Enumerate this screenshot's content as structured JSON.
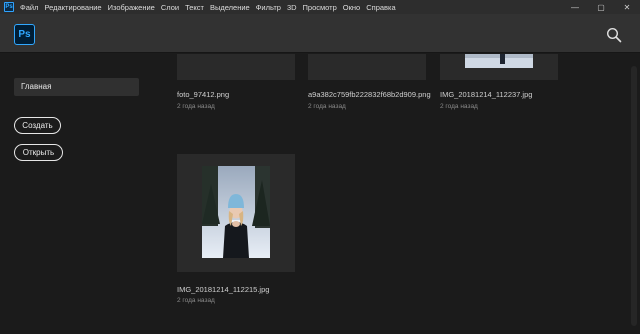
{
  "menubar": {
    "app_icon": "Ps",
    "items": [
      "Файл",
      "Редактирование",
      "Изображение",
      "Слои",
      "Текст",
      "Выделение",
      "Фильтр",
      "3D",
      "Просмотр",
      "Окно",
      "Справка"
    ],
    "window_buttons": [
      "—",
      "▢",
      "✕"
    ]
  },
  "header": {
    "logo": "Ps",
    "search_icon": "search-icon"
  },
  "sidebar": {
    "home_label": "Главная",
    "create_label": "Создать",
    "open_label": "Открыть"
  },
  "files": [
    {
      "name": "foto_97412.png",
      "date": "2 года назад"
    },
    {
      "name": "a9a382c759fb222832f68b2d909.png",
      "date": "2 года назад"
    },
    {
      "name": "IMG_20181214_112237.jpg",
      "date": "2 года назад"
    },
    {
      "name": "IMG_20181214_112215.jpg",
      "date": "2 года назад"
    }
  ],
  "colors": {
    "accent": "#31a8ff",
    "background": "#1b1b1b",
    "header": "#323232"
  }
}
